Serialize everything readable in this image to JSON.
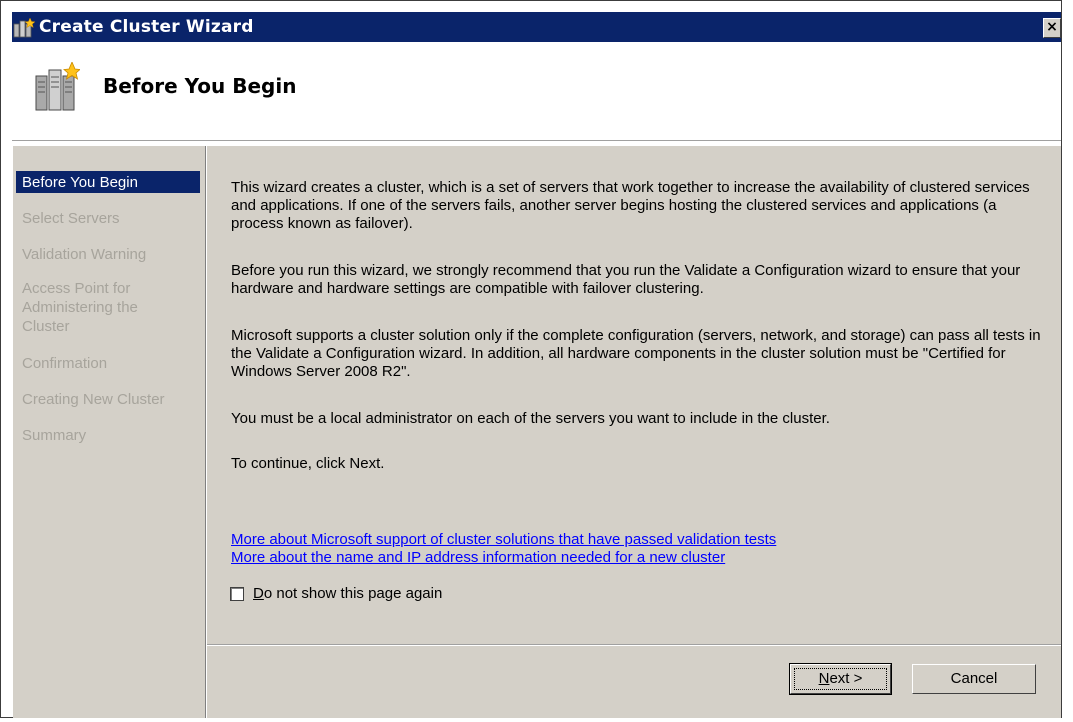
{
  "window": {
    "title": "Create Cluster Wizard",
    "close_glyph": "×"
  },
  "header": {
    "heading": "Before You Begin",
    "icon": "cluster-servers-icon"
  },
  "nav": {
    "items": [
      {
        "label": "Before You Begin",
        "active": true
      },
      {
        "label": "Select Servers",
        "active": false
      },
      {
        "label": "Validation Warning",
        "active": false
      },
      {
        "label": "Access Point for",
        "active": false
      },
      {
        "label": "Administering the",
        "active": false
      },
      {
        "label": "Cluster",
        "active": false
      },
      {
        "label": "Confirmation",
        "active": false
      },
      {
        "label": "Creating New Cluster",
        "active": false
      },
      {
        "label": "Summary",
        "active": false
      }
    ]
  },
  "content": {
    "paragraphs": [
      "This wizard creates a cluster, which is a set of servers that work together to increase the availability of clustered services and applications. If one of the servers fails, another server begins hosting the clustered services and applications (a process known as failover).",
      "Before you run this wizard, we strongly recommend that you run the Validate a Configuration wizard to ensure that your hardware and hardware settings are compatible with failover clustering.",
      "Microsoft supports a cluster solution only if the complete configuration (servers, network, and storage) can pass all tests in the Validate a Configuration wizard.  In addition, all hardware components in the cluster solution must be \"Certified for Windows Server 2008 R2\".",
      "You must be a local administrator on each of the servers you want to include in the cluster.",
      "To continue, click Next."
    ],
    "links": [
      "More about Microsoft support of cluster solutions that have passed validation tests",
      "More about the name and IP address information needed for a new cluster"
    ],
    "checkbox": {
      "label_first": "D",
      "label_rest": "o not show this page again",
      "checked": false
    }
  },
  "footer": {
    "next_first": "N",
    "next_rest": "ext >",
    "cancel_label": "Cancel"
  },
  "colors": {
    "title_bar": "#0a246a",
    "dialog_bg": "#d4d0c8",
    "link": "#0000ff",
    "nav_disabled": "#a7a49c"
  }
}
